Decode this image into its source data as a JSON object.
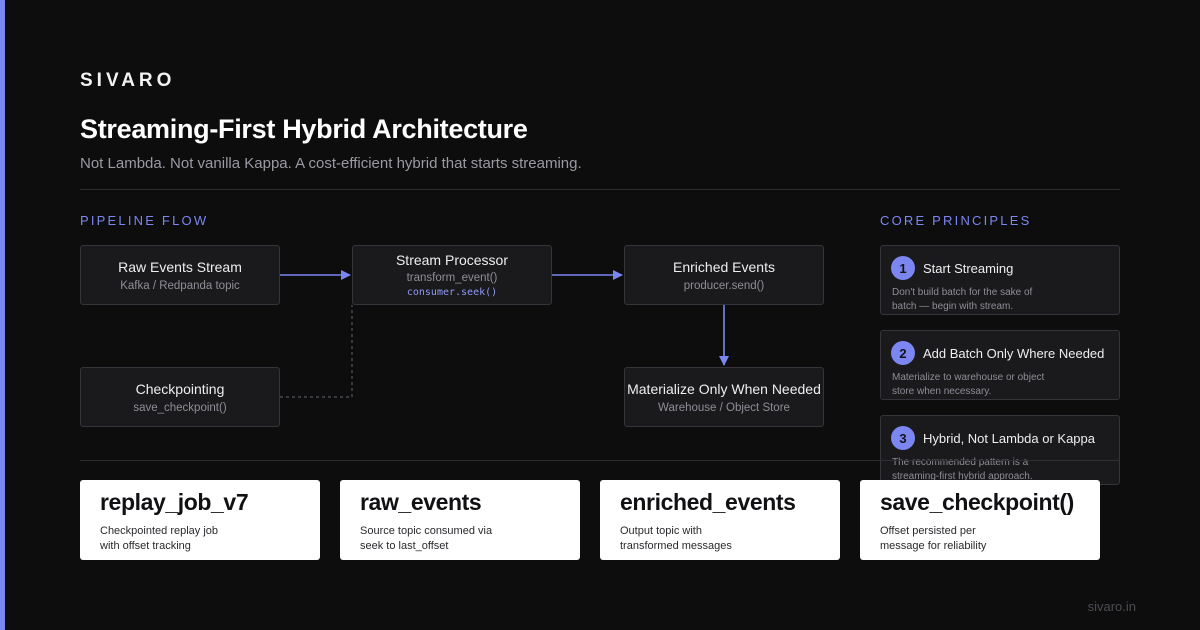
{
  "colors": {
    "accent": "#7b86f0",
    "background": "#0d0d0e",
    "node_fill": "#1a1a1d",
    "card_fill": "#ffffff"
  },
  "brand": "SIVARO",
  "title": "Streaming-First Hybrid Architecture",
  "subtitle": "Not Lambda. Not vanilla Kappa. A cost-efficient hybrid that starts streaming.",
  "pipeline": {
    "label": "PIPELINE FLOW",
    "nodes": {
      "raw": {
        "title": "Raw Events Stream",
        "sub": "Kafka / Redpanda topic"
      },
      "processor": {
        "title": "Stream Processor",
        "sub": "transform_event()",
        "code": "consumer.seek()"
      },
      "enriched": {
        "title": "Enriched Events",
        "sub": "producer.send()"
      },
      "checkpoint": {
        "title": "Checkpointing",
        "sub": "save_checkpoint()"
      },
      "materialize": {
        "title": "Materialize Only When Needed",
        "sub": "Warehouse / Object Store"
      }
    }
  },
  "principles": {
    "label": "CORE PRINCIPLES",
    "items": [
      {
        "number": "1",
        "title": "Start Streaming",
        "desc": "Don't build batch for the sake of batch — begin with stream."
      },
      {
        "number": "2",
        "title": "Add Batch Only Where Needed",
        "desc": "Materialize to warehouse or object store when necessary."
      },
      {
        "number": "3",
        "title": "Hybrid, Not Lambda or Kappa",
        "desc": "The recommended pattern is a streaming-first hybrid approach."
      }
    ]
  },
  "cards": [
    {
      "title": "replay_job_v7",
      "desc": "Checkpointed replay job with offset tracking"
    },
    {
      "title": "raw_events",
      "desc": "Source topic consumed via seek to last_offset"
    },
    {
      "title": "enriched_events",
      "desc": "Output topic with transformed messages"
    },
    {
      "title": "save_checkpoint()",
      "desc": "Offset persisted per message for reliability"
    }
  ],
  "footer": "sivaro.in"
}
